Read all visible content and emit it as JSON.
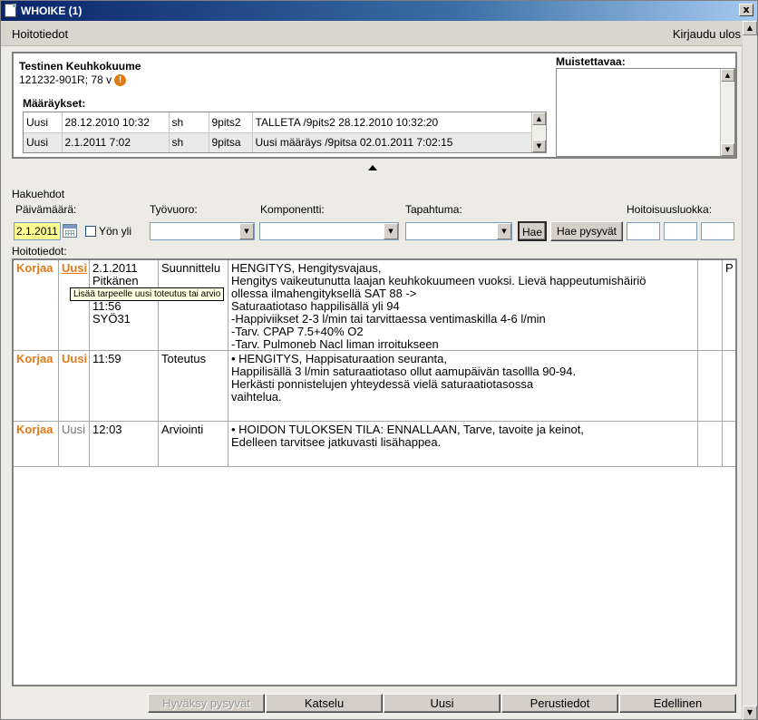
{
  "window": {
    "title": "WHOIKE (1)",
    "close_glyph": "x"
  },
  "topbar": {
    "section": "Hoitotiedot",
    "logout": "Kirjaudu ulos"
  },
  "patient": {
    "name": "Testinen Keuhkokuume",
    "id_age": "121232-901R; 78 v",
    "orders_label": "Määräykset:",
    "orders": [
      {
        "status": "Uusi",
        "datetime": "28.12.2010 10:32",
        "role": "sh",
        "user": "9pits2",
        "text": "TALLETA /9pits2 28.12.2010 10:32:20"
      },
      {
        "status": "Uusi",
        "datetime": "2.1.2011 7:02",
        "role": "sh",
        "user": "9pitsa",
        "text": "Uusi määräys /9pitsa 02.01.2011 7:02:15"
      }
    ],
    "memo_label": "Muistettavaa:"
  },
  "search": {
    "title": "Hakuehdot",
    "date_label": "Päivämäärä:",
    "date_value": "2.1.2011",
    "overnight_label": "Yön yli",
    "shift_label": "Työvuoro:",
    "component_label": "Komponentti:",
    "event_label": "Tapahtuma:",
    "search_button": "Hae",
    "search_keep_button": "Hae pysyvät",
    "class_label": "Hoitoisuusluokka:"
  },
  "records": {
    "label": "Hoitotiedot:",
    "tooltip": "Lisää tarpeelle uusi toteutus tai arvio",
    "rows": [
      {
        "edit": "Korjaa",
        "new": "Uusi",
        "when_lines": [
          "2.1.2011",
          "Pitkänen",
          "",
          "11:56",
          "SYÖ31"
        ],
        "type": "Suunnittelu",
        "lines": [
          "HENGITYS, Hengitysvajaus,",
          "Hengitys vaikeutunutta laajan keuhkokuumeen vuoksi. Lievä happeutumishäiriö",
          "ollessa ilmahengityksellä SAT 88 ->",
          "Saturaatiotaso happilisällä yli 94",
          "-Happiviikset 2-3 l/min tai tarvittaessa ventimaskilla 4-6 l/min",
          "-Tarv. CPAP 7.5+40% O2",
          "-Tarv. Pulmoneb Nacl liman irroitukseen"
        ],
        "extra": "P"
      },
      {
        "edit": "Korjaa",
        "new": "Uusi",
        "when_lines": [
          "11:59"
        ],
        "type": "Toteutus",
        "lines": [
          "• HENGITYS, Happisaturaation seuranta,",
          "Happilisällä 3 l/min saturaatiotaso ollut aamupäivän tasollla 90-94.",
          "Herkästi ponnistelujen yhteydessä vielä saturaatiotasossa",
          "vaihtelua."
        ]
      },
      {
        "edit": "Korjaa",
        "new": "Uusi",
        "when_lines": [
          "12:03"
        ],
        "type": "Arviointi",
        "lines": [
          "• HOIDON TULOKSEN TILA: ENNALLAAN, Tarve, tavoite ja keinot,",
          "Edelleen tarvitsee jatkuvasti lisähappea."
        ]
      }
    ]
  },
  "footer": {
    "approve": "Hyväksy pysyvät",
    "view": "Katselu",
    "new": "Uusi",
    "basic": "Perustiedot",
    "previous": "Edellinen"
  }
}
